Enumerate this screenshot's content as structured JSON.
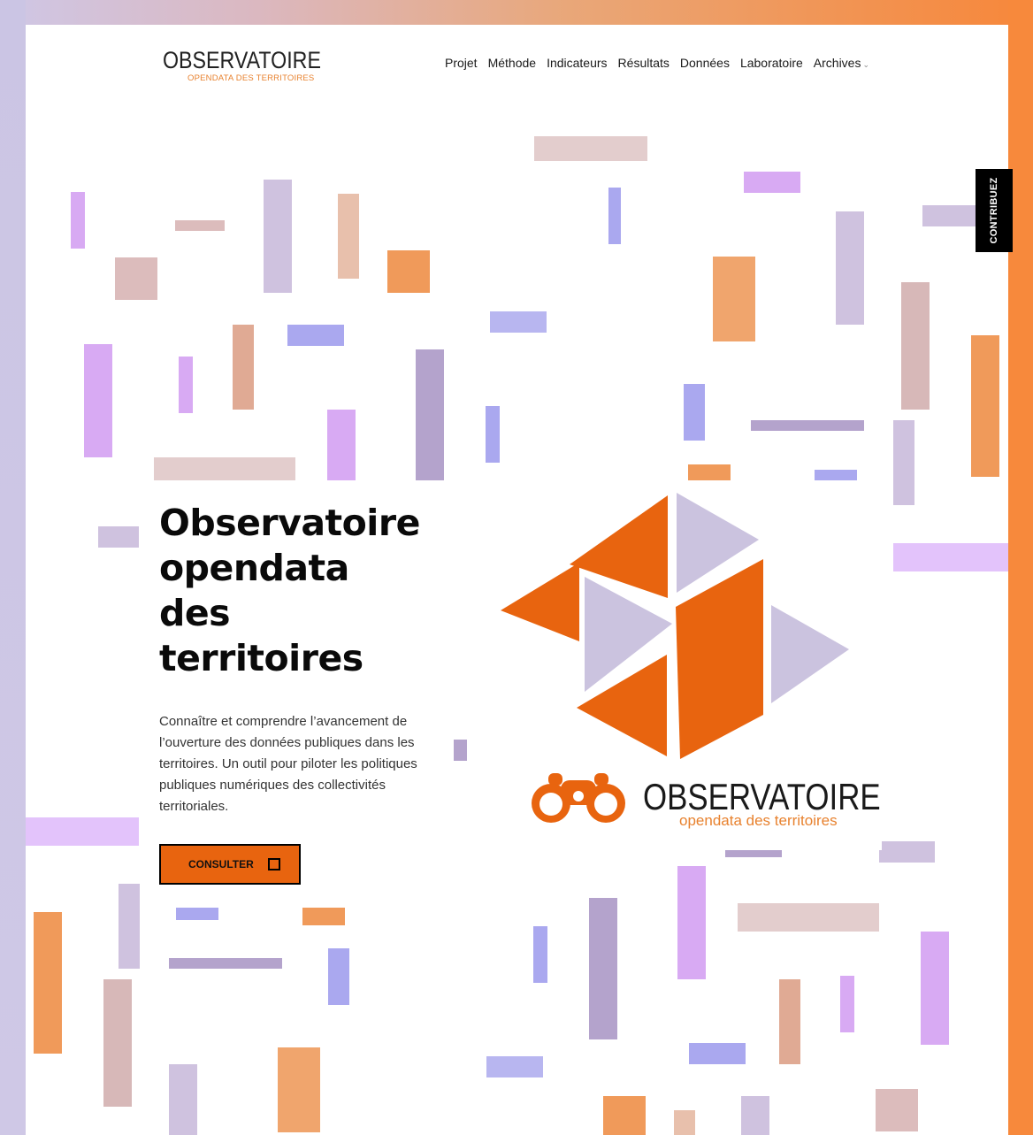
{
  "brand": {
    "name": "OBSERVATOIRE",
    "tagline": "OPENDATA DES TERRITOIRES"
  },
  "nav": [
    "Projet",
    "Méthode",
    "Indicateurs",
    "Résultats",
    "Données",
    "Laboratoire",
    "Archives"
  ],
  "side_tab": "CONTRIBUEZ",
  "hero": {
    "title_lines": [
      "Observatoire",
      "opendata",
      "des",
      "territoires"
    ],
    "description": "Connaître et comprendre l’avancement de l’ouverture des données publiques dans les territoires. Un outil pour piloter les politiques publiques numériques des collectivités territoriales.",
    "cta": "CONSULTER"
  },
  "illustration_logo": {
    "name": "OBSERVATOIRE",
    "tagline": "opendata des territoires"
  },
  "icons": [
    "chevron-down-icon",
    "square-icon",
    "binoculars-icon",
    "tangram-logo-icon"
  ],
  "colors": {
    "accent": "#e8640f",
    "lavender": "#cbc3df",
    "orange": "#f7893c",
    "purple": "#d4a9f2"
  }
}
